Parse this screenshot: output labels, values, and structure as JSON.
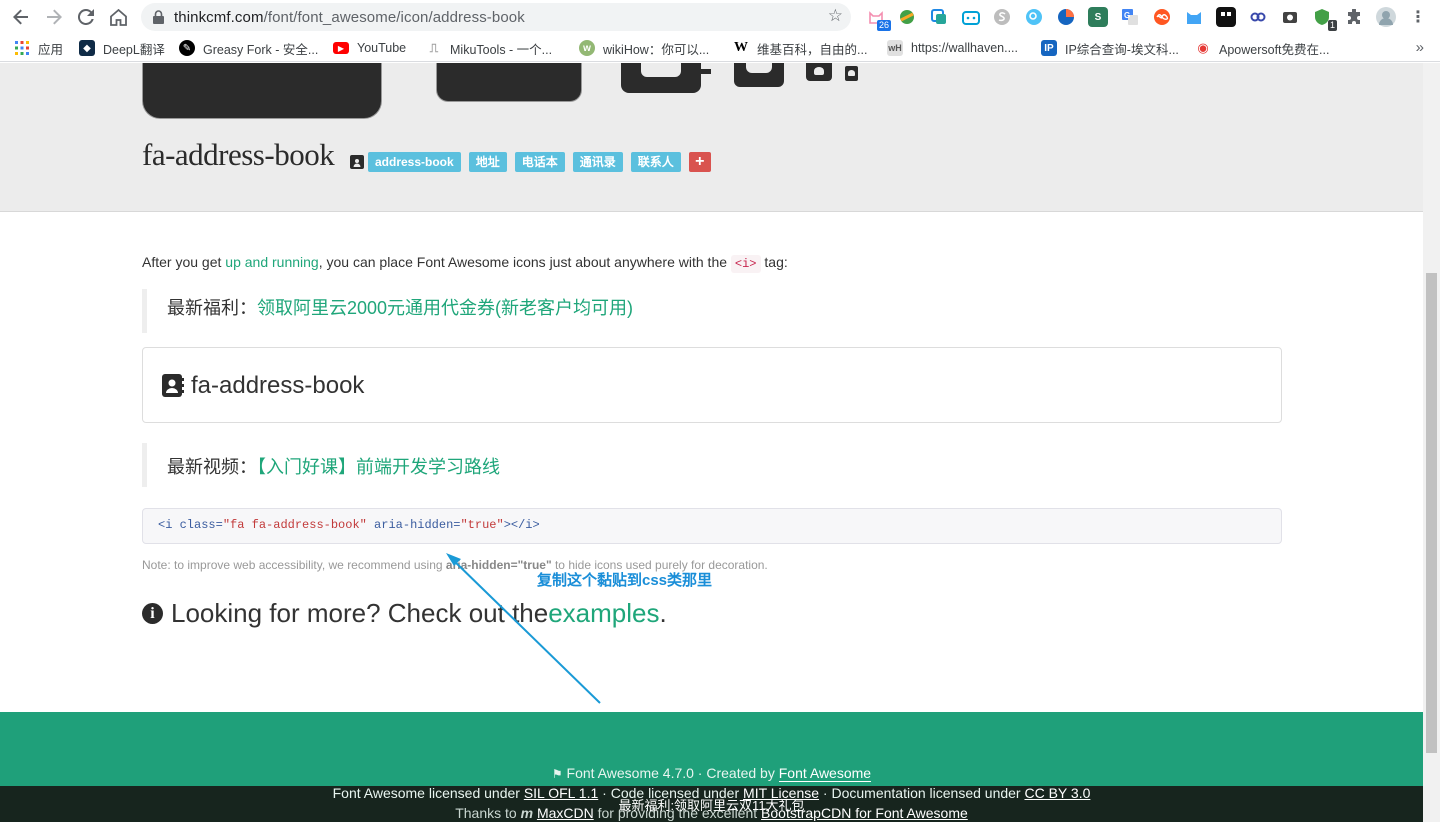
{
  "browser": {
    "url_host": "thinkcmf.com",
    "url_path": "/font/font_awesome/icon/address-book",
    "extension_badges": [
      "26",
      "1"
    ],
    "bookmarks": [
      {
        "label": "应用",
        "icon": "apps-grid-icon",
        "color": "#4285f4"
      },
      {
        "label": "DeepL翻译",
        "icon": "deepl-icon",
        "color": "#0f2b46"
      },
      {
        "label": "Greasy Fork - 安全...",
        "icon": "greasyfork-icon",
        "color": "#000000"
      },
      {
        "label": "YouTube",
        "icon": "youtube-icon",
        "color": "#ff0000"
      },
      {
        "label": "MikuTools - 一个...",
        "icon": "mikutools-icon",
        "color": "#9e9e9e"
      },
      {
        "label": "wikiHow：你可以...",
        "icon": "wikihow-icon",
        "color": "#93b874"
      },
      {
        "label": "维基百科，自由的...",
        "icon": "wikipedia-icon",
        "color": "#000000"
      },
      {
        "label": "https://wallhaven....",
        "icon": "wallhaven-icon",
        "color": "#777777"
      },
      {
        "label": "IP综合查询-埃文科...",
        "icon": "ip-icon",
        "color": "#1565c0"
      },
      {
        "label": "Apowersoft免费在...",
        "icon": "apowersoft-icon",
        "color": "#e53935"
      }
    ]
  },
  "hero": {
    "title": "fa-address-book",
    "tags": [
      "address-book",
      "地址",
      "电话本",
      "通讯录",
      "联系人"
    ],
    "add_tag_label": "+"
  },
  "content": {
    "intro_before": "After you get ",
    "intro_link": "up and running",
    "intro_after": ", you can place Font Awesome icons just about anywhere with the ",
    "intro_tag": "<i>",
    "intro_end": " tag:",
    "promo1_label": "最新福利：",
    "promo1_link": "领取阿里云2000元通用代金券(新老客户均可用)",
    "well_text": "fa-address-book",
    "promo2_label": "最新视频：",
    "promo2_link": "【入门好课】前端开发学习路线",
    "code": {
      "open": "<i ",
      "class_attr": "class=",
      "class_val": "\"fa fa-address-book\"",
      "aria_attr": " aria-hidden=",
      "aria_val": "\"true\"",
      "close": "></i>"
    },
    "note_before": "Note: to improve web accessibility, we recommend using ",
    "note_bold": "aria-hidden=\"true\"",
    "note_after": " to hide icons used purely for decoration.",
    "annotation": "复制这个黏贴到css类那里",
    "more_text": "Looking for more? Check out the ",
    "more_link": "examples",
    "more_end": "."
  },
  "footer": {
    "line1_prefix": "Font Awesome 4.7.0 · Created by ",
    "line1_link": "Font Awesome",
    "line2_a": "Font Awesome licensed under ",
    "line2_link1": "SIL OFL 1.1",
    "line2_b": " · Code licensed under ",
    "line2_link2": "MIT License",
    "line2_c": " · Documentation licensed under ",
    "line2_link3": "CC BY 3.0",
    "line3_a": "Thanks to ",
    "line3_link1": "MaxCDN",
    "line3_b": " for providing the excellent ",
    "line3_link2": "BootstrapCDN for Font Awesome",
    "promo": "最新福利:领取阿里云双11大礼包"
  },
  "colors": {
    "accent": "#1fa67a",
    "footer_bg": "#1fa07a",
    "tag_info": "#5bc0de",
    "tag_danger": "#d9534f",
    "annotation": "#1a8ed8"
  }
}
